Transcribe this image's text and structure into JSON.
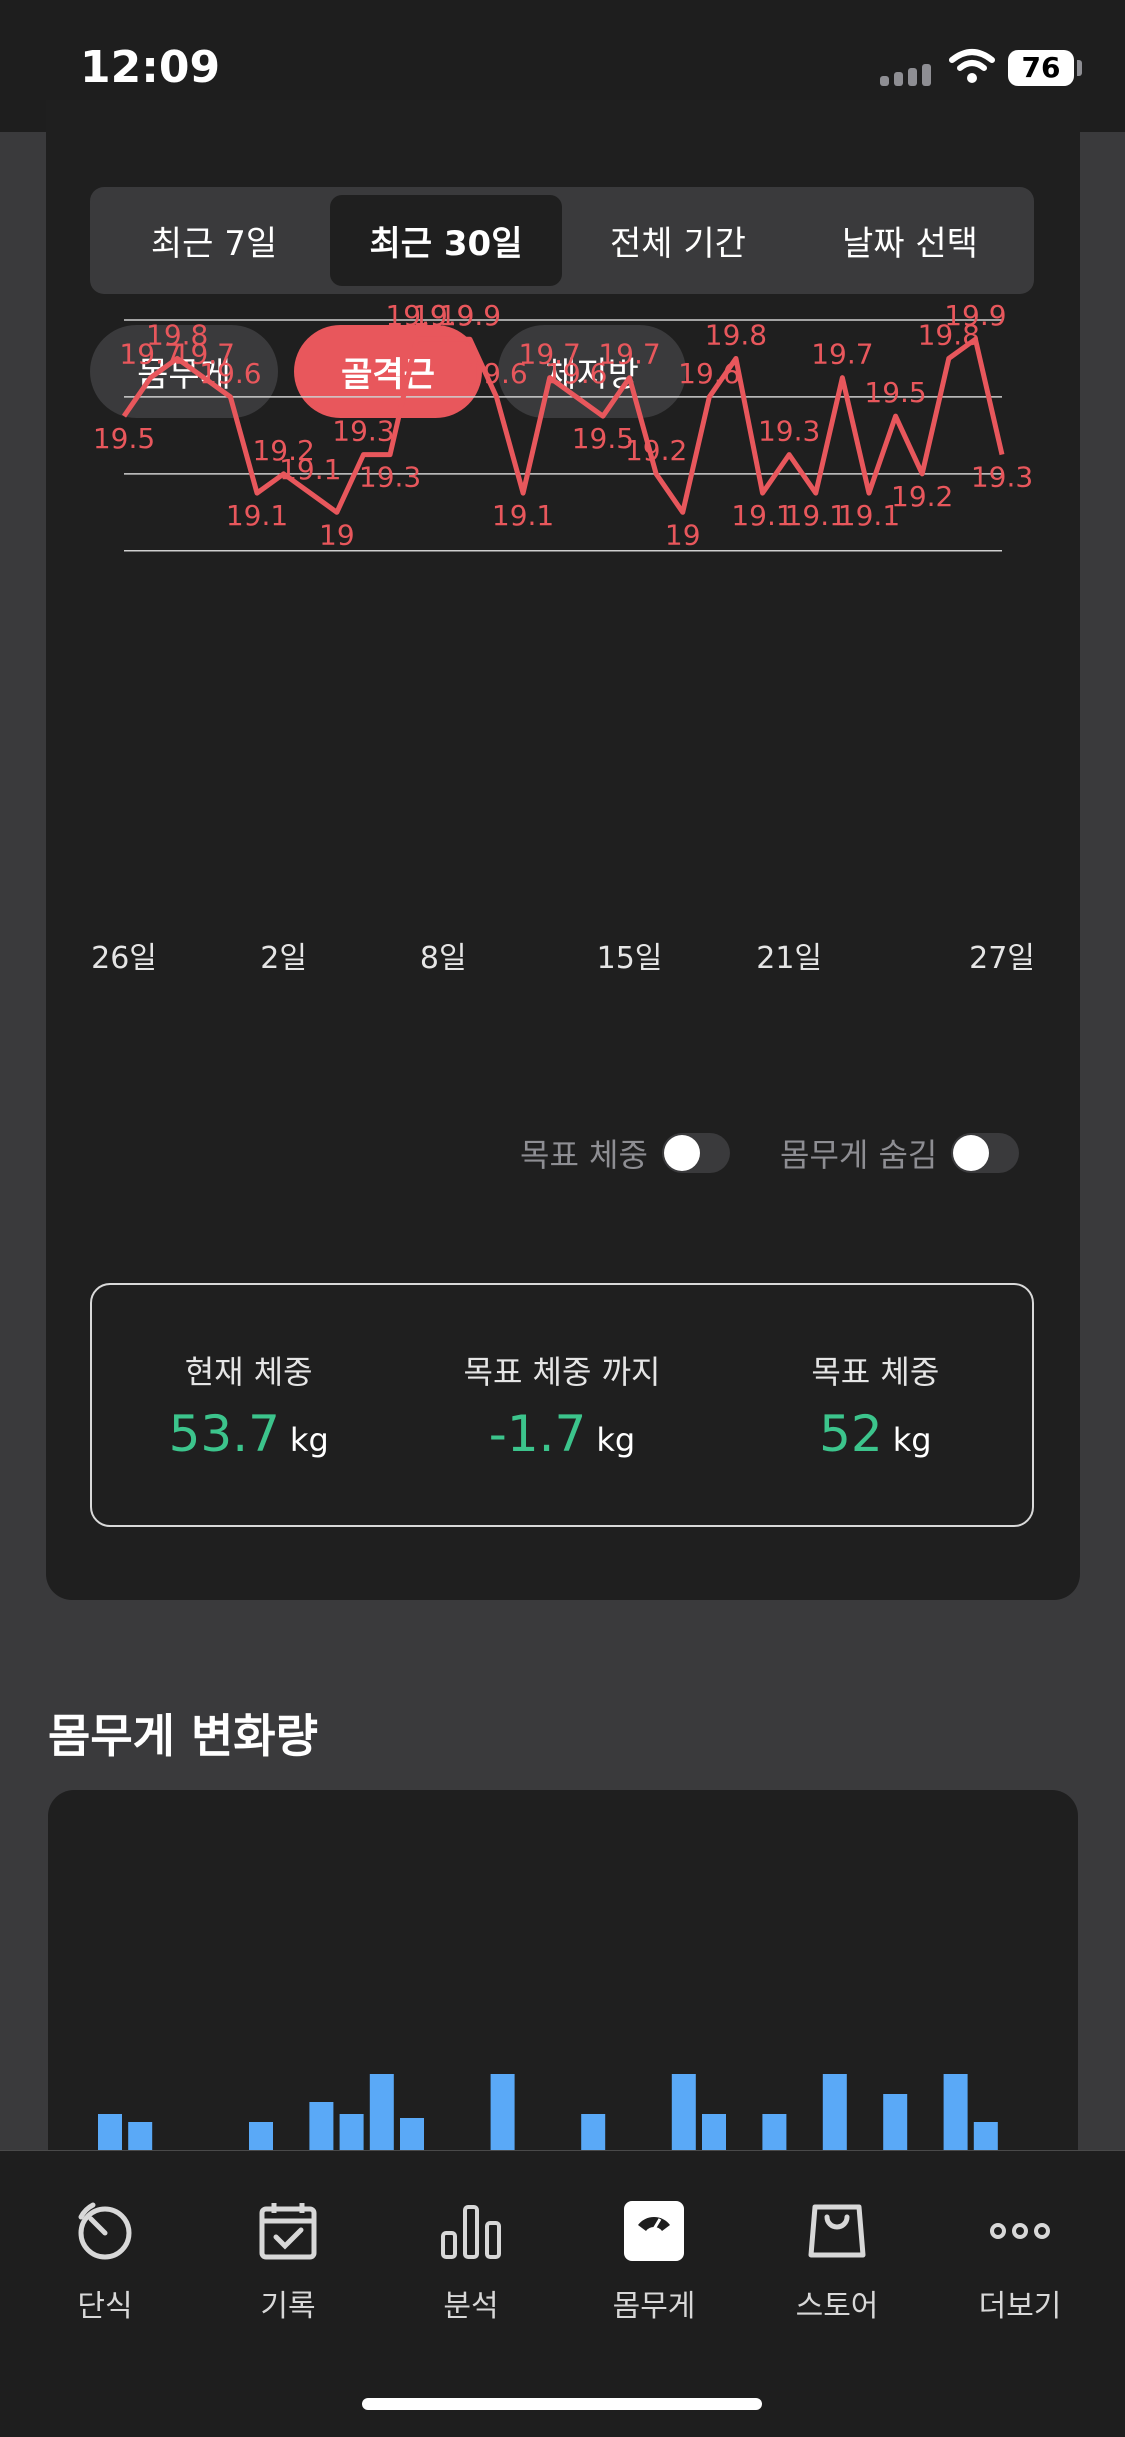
{
  "status": {
    "time": "12:09",
    "battery": "76"
  },
  "range_tabs": [
    "최근 7일",
    "최근 30일",
    "전체 기간",
    "날짜 선택"
  ],
  "range_active_index": 1,
  "metric_pills": [
    "몸무게",
    "골격근",
    "체지방"
  ],
  "metric_active_index": 1,
  "chart_data": {
    "type": "line",
    "color": "#e8575c",
    "x_tick_labels": [
      "26일",
      "2일",
      "8일",
      "15일",
      "21일",
      "27일"
    ],
    "values": [
      19.5,
      19.7,
      19.8,
      19.7,
      19.6,
      19.1,
      19.2,
      19.1,
      19,
      19.3,
      19.3,
      19.9,
      19.9,
      19.9,
      19.6,
      19.1,
      19.7,
      19.6,
      19.5,
      19.7,
      19.2,
      19,
      19.6,
      19.8,
      19.1,
      19.3,
      19.1,
      19.7,
      19.1,
      19.5,
      19.2,
      19.8,
      19.9,
      19.3
    ],
    "ylim": [
      18.7,
      20.0
    ],
    "gridlines": [
      18.8,
      19.2,
      19.6,
      20.0
    ]
  },
  "toggles": {
    "goal_weight": "목표 체중",
    "hide_weight": "몸무게 숨김"
  },
  "summary": {
    "current": {
      "label": "현재 체중",
      "value": "53.7",
      "unit": "kg"
    },
    "to_goal": {
      "label": "목표 체중 까지",
      "value": "-1.7",
      "unit": "kg"
    },
    "goal": {
      "label": "목표 체중",
      "value": "52",
      "unit": "kg"
    }
  },
  "change_section": {
    "title": "몸무게 변화량",
    "bar_color": "#5aa9f7",
    "bars": [
      0.45,
      0.35,
      -0.1,
      -0.1,
      -0.1,
      0.35,
      -0.1,
      0.6,
      0.45,
      0.95,
      0.4,
      -0.1,
      -0.1,
      0.95,
      -0.1,
      -0.1,
      0.45,
      -0.1,
      -0.1,
      0.95,
      0.45,
      -0.1,
      0.45,
      -0.1,
      0.95,
      -0.1,
      0.7,
      -0.1,
      0.95,
      0.35,
      -0.1
    ]
  },
  "tabbar": [
    {
      "label": "단식",
      "icon": "timer-icon"
    },
    {
      "label": "기록",
      "icon": "calendar-check-icon"
    },
    {
      "label": "분석",
      "icon": "bar-chart-icon"
    },
    {
      "label": "몸무게",
      "icon": "scale-icon"
    },
    {
      "label": "스토어",
      "icon": "shopping-bag-icon"
    },
    {
      "label": "더보기",
      "icon": "more-icon"
    }
  ],
  "tabbar_active_index": 3
}
